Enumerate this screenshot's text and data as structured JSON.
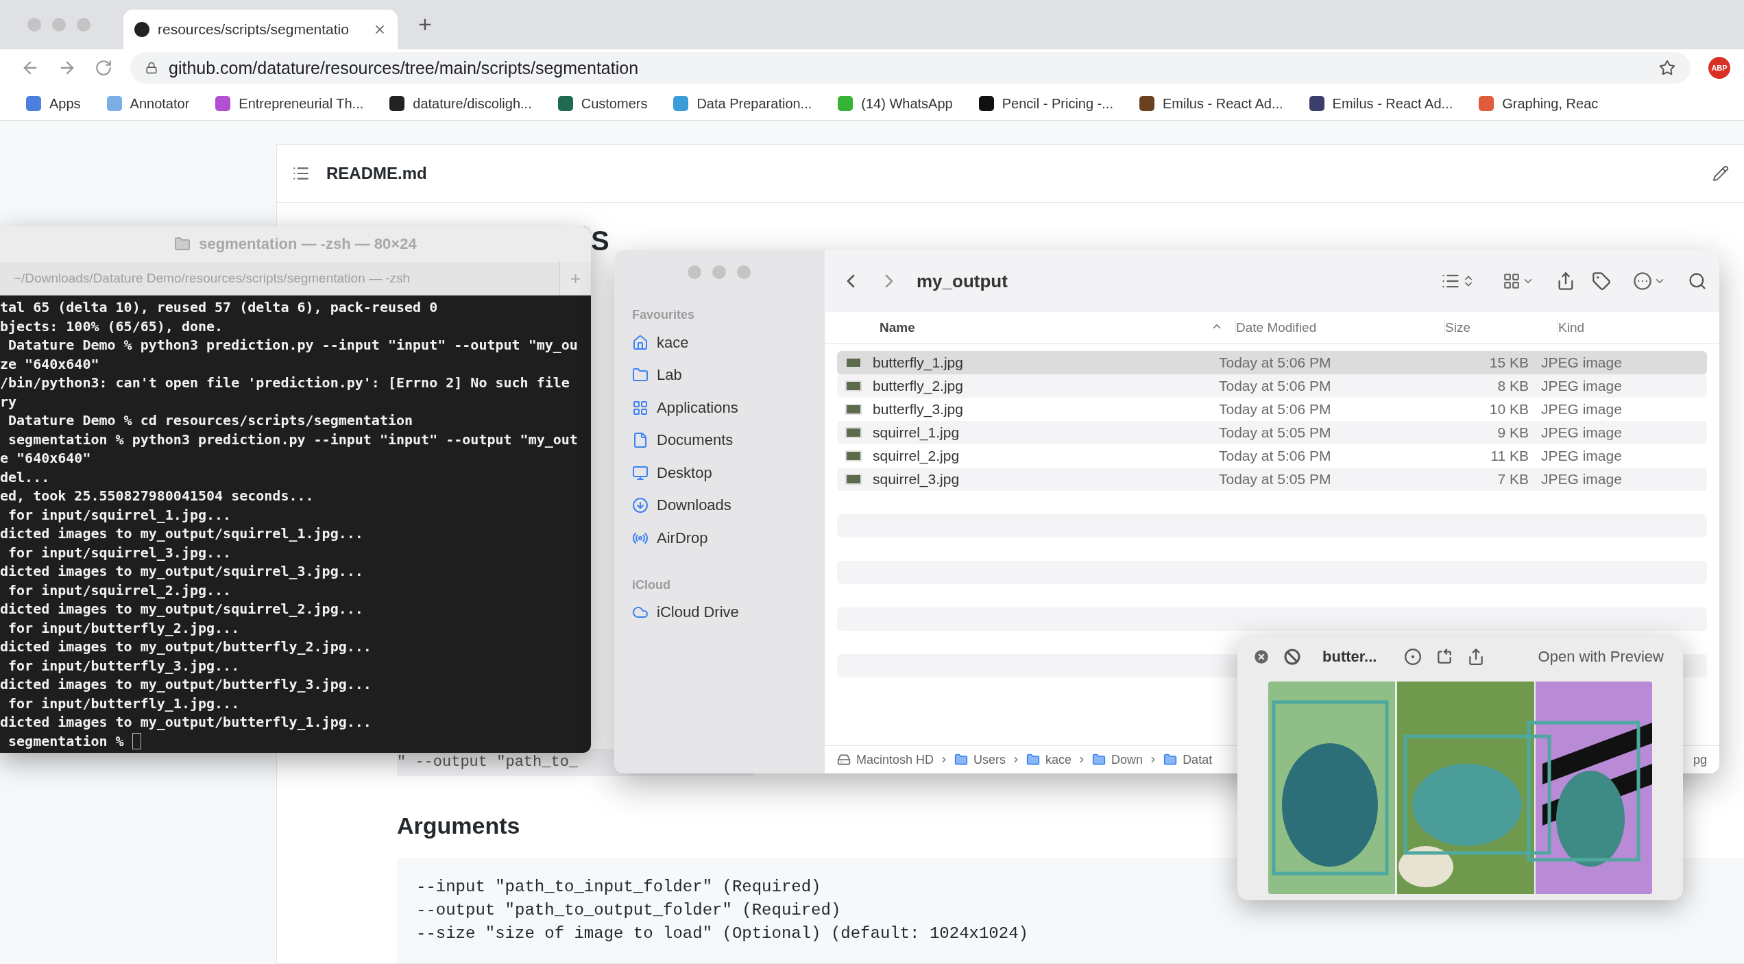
{
  "browser": {
    "tab": {
      "title": "resources/scripts/segmentatio"
    },
    "new_tab": "+",
    "url": "github.com/datature/resources/tree/main/scripts/segmentation",
    "extension": "ABP",
    "bookmarks": [
      {
        "label": "Apps",
        "color": "#4a7fe0"
      },
      {
        "label": "Annotator",
        "color": "#7aaee6"
      },
      {
        "label": "Entrepreneurial Th...",
        "color": "#b24fd3"
      },
      {
        "label": "datature/discoligh...",
        "color": "#222222"
      },
      {
        "label": "Customers",
        "color": "#1f6b50"
      },
      {
        "label": "Data Preparation...",
        "color": "#3c9bd9"
      },
      {
        "label": "(14) WhatsApp",
        "color": "#35b336"
      },
      {
        "label": "Pencil - Pricing -...",
        "color": "#111111"
      },
      {
        "label": "Emilus - React Ad...",
        "color": "#6a4221"
      },
      {
        "label": "Emilus - React Ad...",
        "color": "#3b3d6b"
      },
      {
        "label": "Graphing, Reac",
        "color": "#e05b3b"
      }
    ]
  },
  "readme": {
    "file": "README.md",
    "heading_fragment": "S",
    "code_fragment": "\" --output \"path_to_",
    "arguments_heading": "Arguments",
    "code_lines": [
      "--input \"path_to_input_folder\" (Required)",
      "--output \"path_to_output_folder\" (Required)",
      "--size \"size of image to load\" (Optional) (default: 1024x1024)"
    ]
  },
  "terminal": {
    "title": "segmentation — -zsh — 80×24",
    "tab": "~/Downloads/Datature Demo/resources/scripts/segmentation — -zsh",
    "new_tab": "+",
    "lines": [
      "tal 65 (delta 10), reused 57 (delta 6), pack-reused 0",
      "bjects: 100% (65/65), done.",
      " Datature Demo % python3 prediction.py --input \"input\" --output \"my_ou",
      "ze \"640x640\"",
      "/bin/python3: can't open file 'prediction.py': [Errno 2] No such file",
      "ry",
      " Datature Demo % cd resources/scripts/segmentation",
      " segmentation % python3 prediction.py --input \"input\" --output \"my_out",
      "e \"640x640\"",
      "del...",
      "ed, took 25.550827980041504 seconds...",
      " for input/squirrel_1.jpg...",
      "dicted images to my_output/squirrel_1.jpg...",
      " for input/squirrel_3.jpg...",
      "dicted images to my_output/squirrel_3.jpg...",
      " for input/squirrel_2.jpg...",
      "dicted images to my_output/squirrel_2.jpg...",
      " for input/butterfly_2.jpg...",
      "dicted images to my_output/butterfly_2.jpg...",
      " for input/butterfly_3.jpg...",
      "dicted images to my_output/butterfly_3.jpg...",
      " for input/butterfly_1.jpg...",
      "dicted images to my_output/butterfly_1.jpg...",
      " segmentation % "
    ]
  },
  "finder": {
    "folder": "my_output",
    "sidebar": [
      {
        "heading": "Favourites",
        "items": [
          {
            "label": "kace"
          },
          {
            "label": "Lab"
          },
          {
            "label": "Applications"
          },
          {
            "label": "Documents"
          },
          {
            "label": "Desktop"
          },
          {
            "label": "Downloads"
          },
          {
            "label": "AirDrop"
          }
        ]
      },
      {
        "heading": "iCloud",
        "items": [
          {
            "label": "iCloud Drive"
          }
        ]
      }
    ],
    "columns": [
      "Name",
      "Date Modified",
      "Size",
      "Kind"
    ],
    "rows": [
      {
        "name": "butterfly_1.jpg",
        "modified": "Today at 5:06 PM",
        "size": "15 KB",
        "kind": "JPEG image",
        "selected": true
      },
      {
        "name": "butterfly_2.jpg",
        "modified": "Today at 5:06 PM",
        "size": "8 KB",
        "kind": "JPEG image",
        "selected": false
      },
      {
        "name": "butterfly_3.jpg",
        "modified": "Today at 5:06 PM",
        "size": "10 KB",
        "kind": "JPEG image",
        "selected": false
      },
      {
        "name": "squirrel_1.jpg",
        "modified": "Today at 5:05 PM",
        "size": "9 KB",
        "kind": "JPEG image",
        "selected": false
      },
      {
        "name": "squirrel_2.jpg",
        "modified": "Today at 5:06 PM",
        "size": "11 KB",
        "kind": "JPEG image",
        "selected": false
      },
      {
        "name": "squirrel_3.jpg",
        "modified": "Today at 5:05 PM",
        "size": "7 KB",
        "kind": "JPEG image",
        "selected": false
      }
    ],
    "path": [
      "Macintosh HD",
      "Users",
      "kace",
      "Down",
      "Datat"
    ],
    "path_tail": "pg"
  },
  "quicklook": {
    "title": "butter...",
    "button": "Open with Preview"
  }
}
